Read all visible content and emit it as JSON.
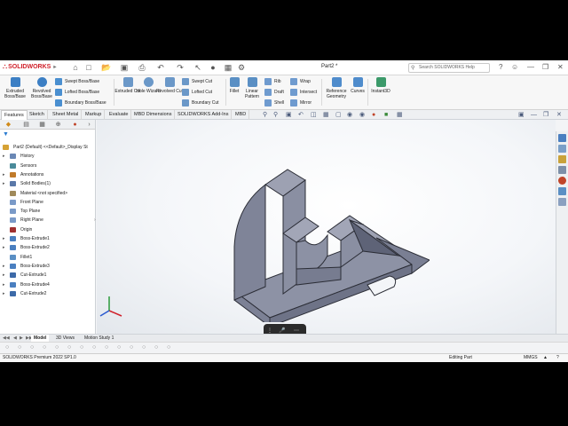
{
  "app": {
    "brand": "SOLIDWORKS",
    "document_title": "Part2 *",
    "search_placeholder": "Search SOLIDWORKS Help",
    "accent_color": "#d0202a"
  },
  "quick_access": [
    "home-icon",
    "new-file-icon",
    "open-icon",
    "save-icon",
    "print-icon",
    "undo-icon",
    "redo-icon",
    "select-icon",
    "rebuild-icon",
    "options-icon"
  ],
  "commands": {
    "extruded_boss": "Extruded Boss/Base",
    "revolved_boss": "Revolved Boss/Base",
    "swept_boss": "Swept Boss/Base",
    "lofted_boss": "Lofted Boss/Base",
    "boundary_boss": "Boundary Boss/Base",
    "extruded_cut": "Extruded Cut",
    "hole_wizard": "Hole Wizard",
    "revolved_cut": "Revolved Cut",
    "swept_cut": "Swept Cut",
    "lofted_cut": "Lofted Cut",
    "boundary_cut": "Boundary Cut",
    "fillet": "Fillet",
    "linear_pattern": "Linear Pattern",
    "rib": "Rib",
    "draft": "Draft",
    "shell": "Shell",
    "wrap": "Wrap",
    "intersect": "Intersect",
    "mirror": "Mirror",
    "reference_geometry": "Reference Geometry",
    "curves": "Curves",
    "instant3d": "Instant3D"
  },
  "command_tabs": [
    "Features",
    "Sketch",
    "Sheet Metal",
    "Markup",
    "Evaluate",
    "MBD Dimensions",
    "SOLIDWORKS Add-Ins",
    "MBD"
  ],
  "active_command_tab": "Features",
  "feature_tree": [
    {
      "label": "Part2 (Default) <<Default>_Display St",
      "icon": "part-icon",
      "expandable": false,
      "level": 0
    },
    {
      "label": "History",
      "icon": "history-icon",
      "expandable": true,
      "level": 1
    },
    {
      "label": "Sensors",
      "icon": "sensor-icon",
      "expandable": false,
      "level": 1
    },
    {
      "label": "Annotations",
      "icon": "annotation-icon",
      "expandable": true,
      "level": 1
    },
    {
      "label": "Solid Bodies(1)",
      "icon": "solid-body-icon",
      "expandable": true,
      "level": 1
    },
    {
      "label": "Material <not specified>",
      "icon": "material-icon",
      "expandable": false,
      "level": 1
    },
    {
      "label": "Front Plane",
      "icon": "plane-icon",
      "expandable": false,
      "level": 1
    },
    {
      "label": "Top Plane",
      "icon": "plane-icon",
      "expandable": false,
      "level": 1
    },
    {
      "label": "Right Plane",
      "icon": "plane-icon",
      "expandable": false,
      "level": 1
    },
    {
      "label": "Origin",
      "icon": "origin-icon",
      "expandable": false,
      "level": 1
    },
    {
      "label": "Boss-Extrude1",
      "icon": "extrude-icon",
      "expandable": true,
      "level": 1
    },
    {
      "label": "Boss-Extrude2",
      "icon": "extrude-icon",
      "expandable": true,
      "level": 1
    },
    {
      "label": "Fillet1",
      "icon": "fillet-icon",
      "expandable": false,
      "level": 1
    },
    {
      "label": "Boss-Extrude3",
      "icon": "extrude-icon",
      "expandable": true,
      "level": 1
    },
    {
      "label": "Cut-Extrude1",
      "icon": "cut-icon",
      "expandable": true,
      "level": 1
    },
    {
      "label": "Boss-Extrude4",
      "icon": "extrude-icon",
      "expandable": true,
      "level": 1
    },
    {
      "label": "Cut-Extrude2",
      "icon": "cut-icon",
      "expandable": true,
      "level": 1
    }
  ],
  "bottom_tabs": [
    "Model",
    "3D Views",
    "Motion Study 1"
  ],
  "active_bottom_tab": "Model",
  "status": {
    "left": "SOLIDWORKS Premium 2022 SP1.0",
    "mode": "Editing Part",
    "units": "MMGS"
  },
  "colors": {
    "model_face": "#8a8fa2",
    "model_top": "#a6aabb",
    "model_dark": "#6e7387"
  }
}
